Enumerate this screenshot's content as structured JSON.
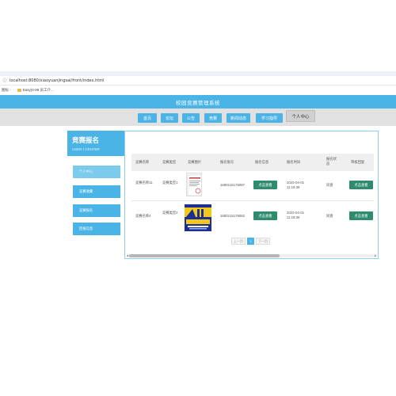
{
  "browser": {
    "url": "localhost:8080/xiaoyuanjingsai/front/index.html",
    "bookmarks": [
      "图标 -",
      "Easy(0-99 员工介..."
    ]
  },
  "header": {
    "title": "校园竞赛管理系统"
  },
  "nav": {
    "items": [
      "首页",
      "论坛",
      "公告",
      "竞赛",
      "新闻动态",
      "学习指导",
      "个人中心"
    ]
  },
  "sidebar": {
    "title": "竞赛报名",
    "subtitle": "USER / CENTER",
    "items": [
      "个人中心",
      "竞赛收藏",
      "竞赛报名",
      "回报信息"
    ]
  },
  "table": {
    "headers": [
      "竞赛名称",
      "竞赛类型",
      "竞赛图片",
      "报名账号",
      "报名信息",
      "报名时间",
      "报名状态",
      "审核回复"
    ],
    "rows": [
      {
        "name": "竞赛名称11",
        "type": "竞赛类型1",
        "account": "1680215179087",
        "info_button": "点击查看",
        "time": "2023-04-01 11:19:39",
        "status": "同意",
        "reply_button": "点击查看"
      },
      {
        "name": "竞赛名称4",
        "type": "竞赛类型2",
        "account": "1680215179082",
        "info_button": "点击查看",
        "time": "2023-04-01 11:19:39",
        "status": "同意",
        "reply_button": "点击查看"
      }
    ]
  },
  "pagination": {
    "prev": "上一页",
    "current": "1",
    "next": "下一页"
  },
  "colors": {
    "brand": "#4bb4e6",
    "action_green": "#2e8b6e",
    "nav_bg": "#e1e1e1"
  }
}
